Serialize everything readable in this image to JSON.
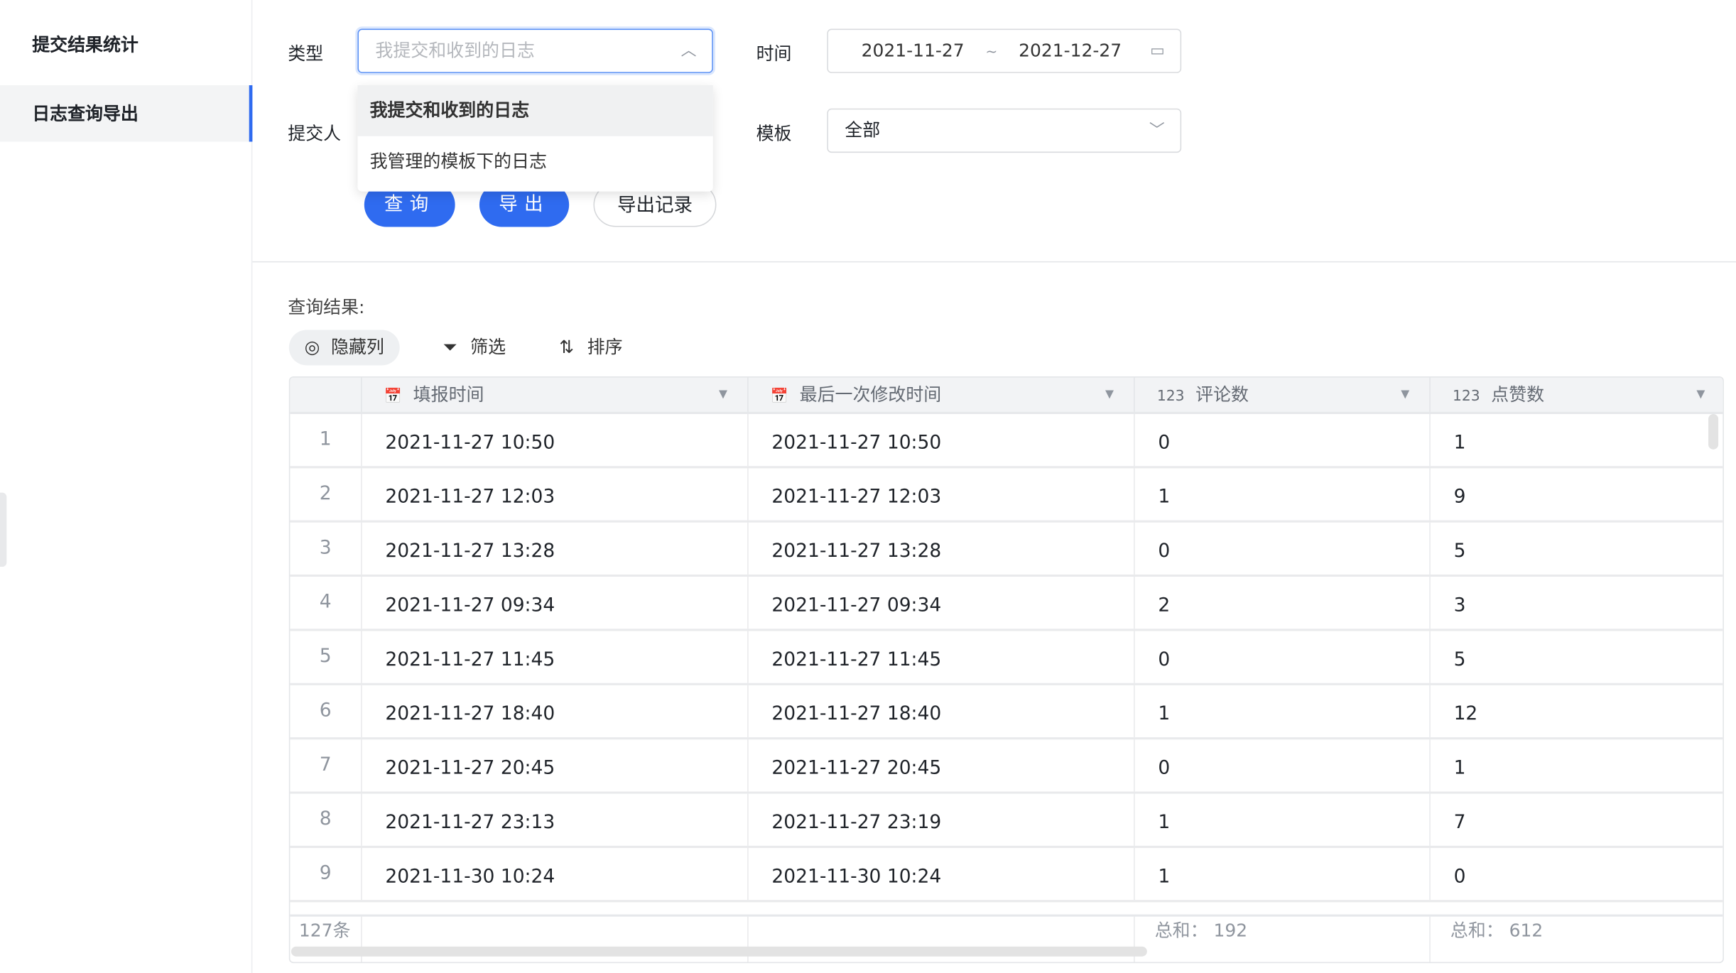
{
  "sidebar": {
    "items": [
      {
        "label": "提交结果统计",
        "active": false
      },
      {
        "label": "日志查询导出",
        "active": true
      }
    ]
  },
  "filters": {
    "type_label": "类型",
    "type_placeholder": "我提交和收到的日志",
    "type_options": [
      "我提交和收到的日志",
      "我管理的模板下的日志"
    ],
    "submitter_label": "提交人",
    "time_label": "时间",
    "date_start": "2021-11-27",
    "date_sep": "~",
    "date_end": "2021-12-27",
    "template_label": "模板",
    "template_value": "全部"
  },
  "actions": {
    "query": "查询",
    "export": "导出",
    "export_log": "导出记录"
  },
  "results": {
    "title": "查询结果:",
    "toolbar": {
      "hide_columns": "隐藏列",
      "filter": "筛选",
      "sort": "排序"
    },
    "columns": [
      {
        "label": "填报时间",
        "icon": "calendar-icon"
      },
      {
        "label": "最后一次修改时间",
        "icon": "calendar-icon"
      },
      {
        "label": "评论数",
        "icon": "number-icon"
      },
      {
        "label": "点赞数",
        "icon": "number-icon"
      }
    ],
    "rows": [
      [
        "1",
        "2021-11-27 10:50",
        "2021-11-27 10:50",
        "0",
        "1"
      ],
      [
        "2",
        "2021-11-27 12:03",
        "2021-11-27 12:03",
        "1",
        "9"
      ],
      [
        "3",
        "2021-11-27 13:28",
        "2021-11-27 13:28",
        "0",
        "5"
      ],
      [
        "4",
        "2021-11-27 09:34",
        "2021-11-27 09:34",
        "2",
        "3"
      ],
      [
        "5",
        "2021-11-27 11:45",
        "2021-11-27 11:45",
        "0",
        "5"
      ],
      [
        "6",
        "2021-11-27 18:40",
        "2021-11-27 18:40",
        "1",
        "12"
      ],
      [
        "7",
        "2021-11-27 20:45",
        "2021-11-27 20:45",
        "0",
        "1"
      ],
      [
        "8",
        "2021-11-27 23:13",
        "2021-11-27 23:19",
        "1",
        "7"
      ],
      [
        "9",
        "2021-11-30 10:24",
        "2021-11-30 10:24",
        "1",
        "0"
      ]
    ],
    "footer": {
      "count": "127条",
      "comments_sum": "总和： 192",
      "likes_sum": "总和： 612"
    }
  },
  "colors": {
    "accent": "#2f6bf0",
    "active_bg": "#f3f4f5"
  }
}
